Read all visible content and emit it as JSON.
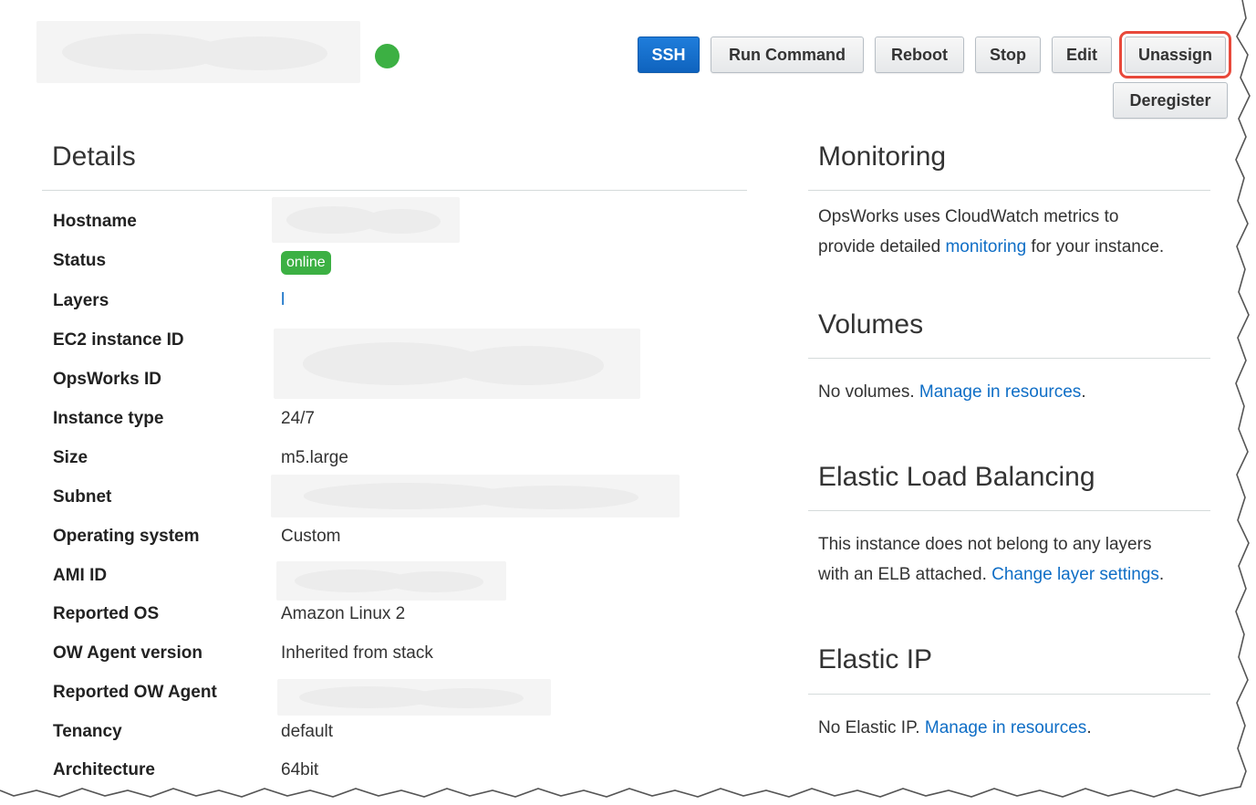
{
  "header": {
    "buttons": {
      "ssh": "SSH",
      "run_command": "Run Command",
      "reboot": "Reboot",
      "stop": "Stop",
      "edit": "Edit",
      "unassign": "Unassign",
      "deregister": "Deregister"
    },
    "status_color": "#3cb043",
    "highlight_color": "#e8493b",
    "primary_color": "#1272d3"
  },
  "details": {
    "title": "Details",
    "rows": [
      {
        "label": "Hostname",
        "value": ""
      },
      {
        "label": "Status",
        "value": "online"
      },
      {
        "label": "Layers",
        "value": "l"
      },
      {
        "label": "EC2 instance ID",
        "value": ""
      },
      {
        "label": "OpsWorks ID",
        "value": ""
      },
      {
        "label": "Instance type",
        "value": "24/7"
      },
      {
        "label": "Size",
        "value": "m5.large"
      },
      {
        "label": "Subnet",
        "value": ""
      },
      {
        "label": "Operating system",
        "value": "Custom"
      },
      {
        "label": "AMI ID",
        "value": ""
      },
      {
        "label": "Reported OS",
        "value": "Amazon Linux 2"
      },
      {
        "label": "OW Agent version",
        "value": "Inherited from stack"
      },
      {
        "label": "Reported OW Agent",
        "value": ""
      },
      {
        "label": "Tenancy",
        "value": "default"
      },
      {
        "label": "Architecture",
        "value": "64bit"
      }
    ]
  },
  "monitoring": {
    "title": "Monitoring",
    "text_line1": "OpsWorks uses CloudWatch metrics to",
    "text_pre_link": "provide detailed ",
    "link": "monitoring",
    "text_post_link": " for your instance."
  },
  "volumes": {
    "title": "Volumes",
    "text": "No volumes. ",
    "link": "Manage in resources",
    "text_post": "."
  },
  "elb": {
    "title": "Elastic Load Balancing",
    "text_line1": "This instance does not belong to any layers",
    "text_pre_link": "with an ELB attached. ",
    "link": "Change layer settings",
    "text_post": "."
  },
  "elastic_ip": {
    "title": "Elastic IP",
    "text": "No Elastic IP. ",
    "link": "Manage in resources",
    "text_post": "."
  }
}
